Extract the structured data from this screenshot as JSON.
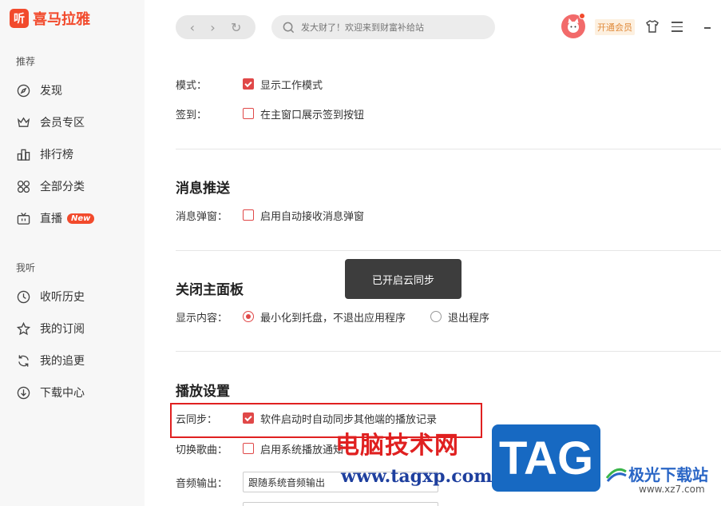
{
  "app": {
    "logo_mark": "听",
    "logo_text": "喜马拉雅"
  },
  "sidebar": {
    "section1": "推荐",
    "section2": "我听",
    "items": [
      {
        "label": "发现"
      },
      {
        "label": "会员专区"
      },
      {
        "label": "排行榜"
      },
      {
        "label": "全部分类"
      },
      {
        "label": "直播",
        "badge": "New"
      },
      {
        "label": "收听历史"
      },
      {
        "label": "我的订阅"
      },
      {
        "label": "我的追更"
      },
      {
        "label": "下载中心"
      }
    ]
  },
  "topbar": {
    "search_placeholder": "发大财了！欢迎来到财富补给站",
    "vip_label": "开通会员"
  },
  "settings": {
    "mode_label": "模式：",
    "mode_option": "显示工作模式",
    "mode_checked": true,
    "signin_label": "签到：",
    "signin_option": "在主窗口展示签到按钮",
    "signin_checked": false,
    "push_title": "消息推送",
    "popup_label": "消息弹窗：",
    "popup_option": "启用自动接收消息弹窗",
    "popup_checked": false,
    "close_title": "关闭主面板",
    "display_label": "显示内容：",
    "display_options": [
      "最小化到托盘，不退出应用程序",
      "退出程序"
    ],
    "display_selected": 0,
    "play_title": "播放设置",
    "cloud_label": "云同步：",
    "cloud_option": "软件启动时自动同步其他端的播放记录",
    "cloud_checked": true,
    "switch_label": "切换歌曲：",
    "switch_option": "启用系统播放通知",
    "switch_checked": false,
    "audio_label": "音频输出：",
    "audio_value": "跟随系统音频输出"
  },
  "toast": "已开启云同步",
  "watermark": {
    "cn": "电脑技术网",
    "url": "www.tagxp.com",
    "tag": "TAG",
    "site_name": "极光下载站",
    "site_url": "www.xz7.com"
  },
  "colors": {
    "brand": "#f24a2c",
    "checkbox": "#e04848",
    "highlight": "#e02020"
  }
}
